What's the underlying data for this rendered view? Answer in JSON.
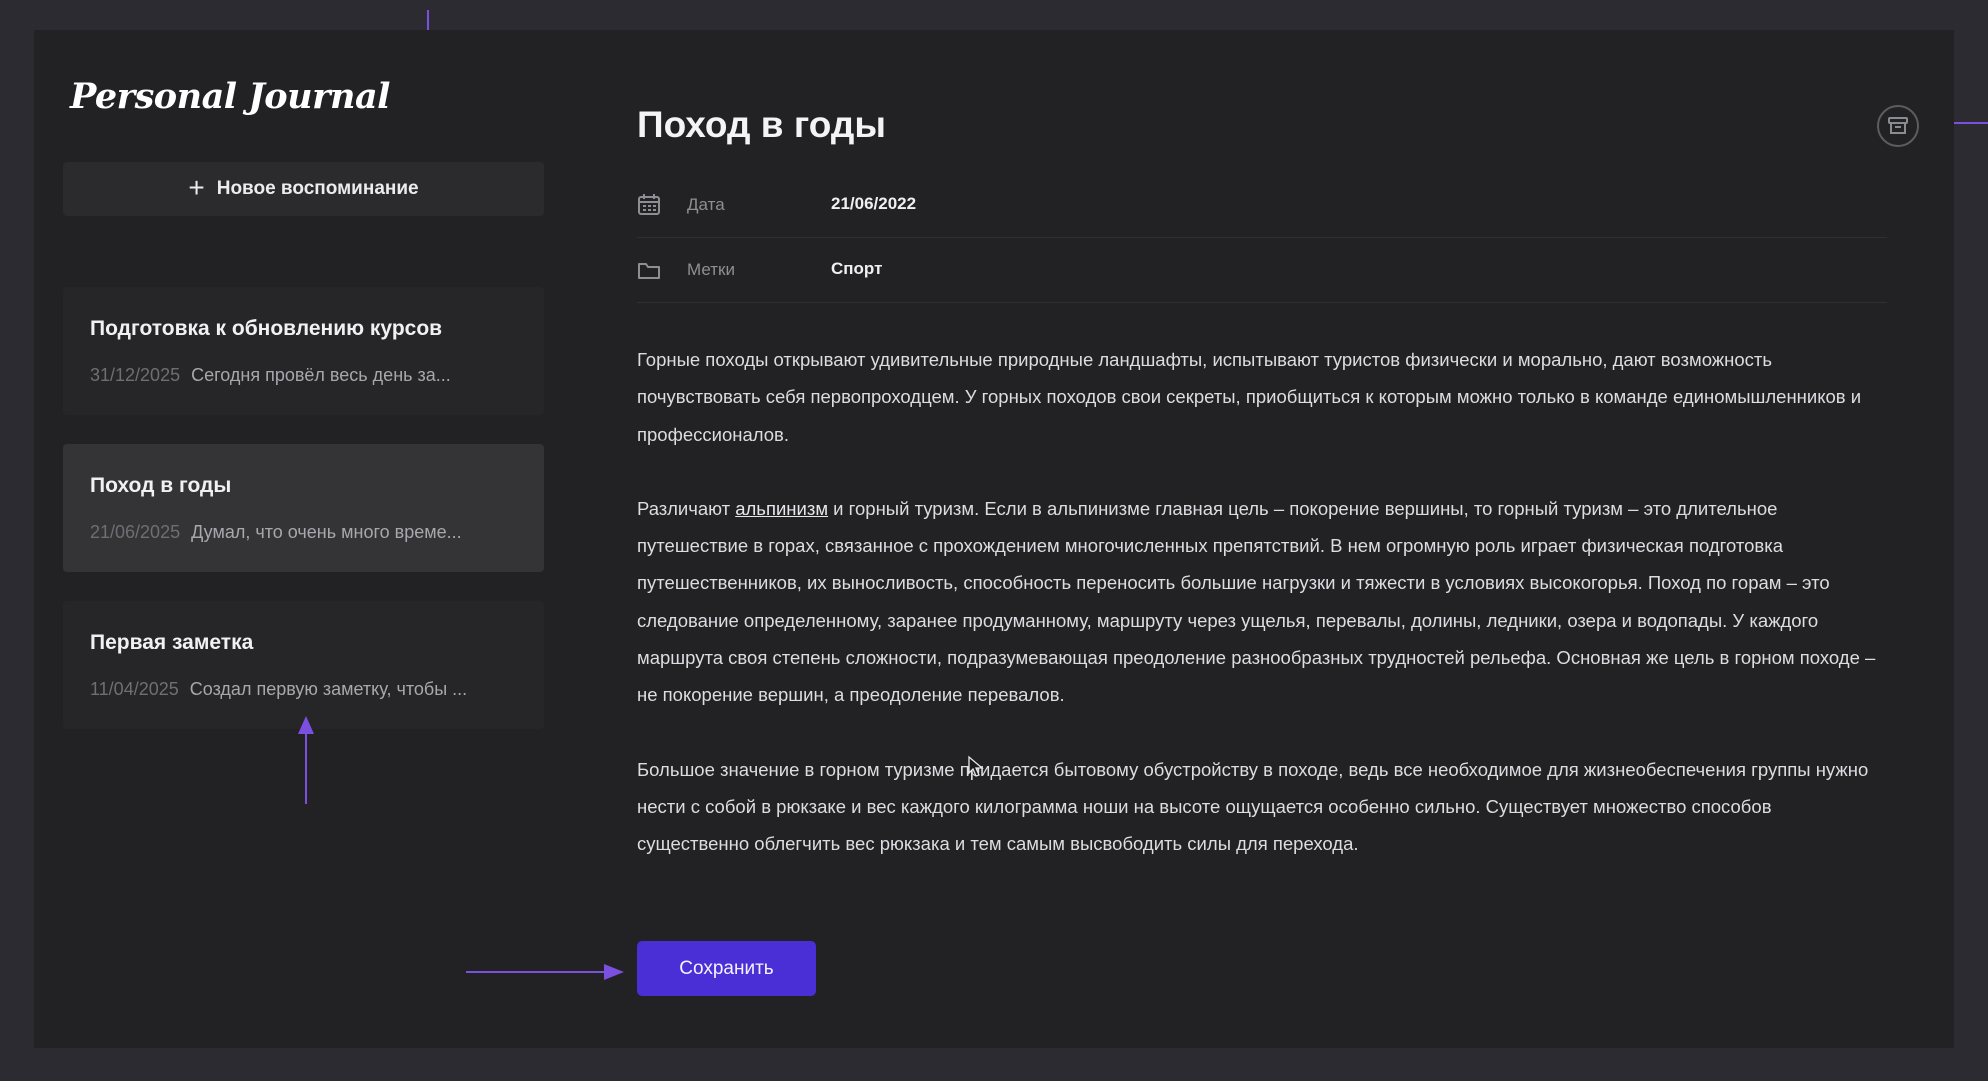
{
  "app": {
    "logo": "Personal Journal"
  },
  "sidebar": {
    "new_button_label": "Новое воспоминание",
    "entries": [
      {
        "title": "Подготовка к обновлению курсов",
        "date": "31/12/2025",
        "preview": "Сегодня провёл весь день за...",
        "active": false
      },
      {
        "title": "Поход в годы",
        "date": "21/06/2025",
        "preview": "Думал, что очень много време...",
        "active": true
      },
      {
        "title": "Первая заметка",
        "date": "11/04/2025",
        "preview": "Создал первую заметку, чтобы ...",
        "active": false
      }
    ]
  },
  "editor": {
    "title": "Поход в годы",
    "date_label": "Дата",
    "date_value": "21/06/2022",
    "tags_label": "Метки",
    "tags_value": "Спорт",
    "paragraph1": "Горные походы открывают удивительные природные ландшафты, испытывают туристов физически и морально, дают возможность почувствовать себя первопроходцем. У горных походов свои секреты, приобщиться к которым можно только в команде единомышленников и профессионалов.",
    "paragraph2_before": "Различают ",
    "paragraph2_link": "альпинизм",
    "paragraph2_after": " и горный туризм. Если в альпинизме главная цель – покорение вершины, то горный туризм – это длительное путешествие в горах, связанное с прохождением многочисленных препятствий. В нем огромную роль играет физическая подготовка путешественников, их выносливость, способность переносить большие нагрузки и тяжести в условиях высокогорья. Поход по горам – это следование определенному, заранее продуманному, маршруту через ущелья, перевалы, долины, ледники, озера и водопады. У каждого маршрута своя степень сложности, подразумевающая преодоление разнообразных трудностей рельефа. Основная же цель в горном походе – не покорение вершин, а преодоление перевалов.",
    "paragraph3": "Большое значение в горном туризме придается бытовому обустройству в походе, ведь все необходимое для жизнеобеспечения группы нужно нести с собой в рюкзаке и вес каждого килограмма ноши на высоте ощущается особенно сильно. Существует множество способов существенно облегчить вес рюкзака и тем самым высвободить силы для перехода.",
    "save_label": "Сохранить"
  },
  "colors": {
    "accent": "#4a2fd6",
    "annotation_arrow": "#7b4fe0",
    "background": "#222224"
  },
  "icons": {
    "add": "plus-icon",
    "date": "calendar-icon",
    "tags": "folder-icon",
    "archive": "archive-icon"
  }
}
